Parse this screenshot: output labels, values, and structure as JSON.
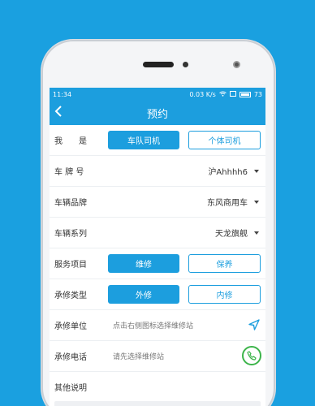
{
  "status": {
    "time": "11:34",
    "speed": "0.03",
    "speed_unit": "K/s",
    "battery": "73"
  },
  "nav": {
    "title": "预约"
  },
  "form": {
    "role": {
      "label": "我　　是",
      "option1": "车队司机",
      "option2": "个体司机"
    },
    "plate": {
      "label": "车 牌 号",
      "value": "沪Ahhhh6"
    },
    "brand": {
      "label": "车辆品牌",
      "value": "东风商用车"
    },
    "series": {
      "label": "车辆系列",
      "value": "天龙旗舰"
    },
    "service": {
      "label": "服务项目",
      "option1": "维修",
      "option2": "保养"
    },
    "repair_type": {
      "label": "承修类型",
      "option1": "外修",
      "option2": "内修"
    },
    "repair_unit": {
      "label": "承修单位",
      "placeholder": "点击右侧图标选择维修站"
    },
    "repair_phone": {
      "label": "承修电话",
      "placeholder": "请先选择维修站"
    },
    "notes": {
      "label": "其他说明"
    }
  },
  "colors": {
    "accent": "#1c9ede",
    "phone_green": "#3cb44a",
    "background": "#1aa0e0"
  }
}
